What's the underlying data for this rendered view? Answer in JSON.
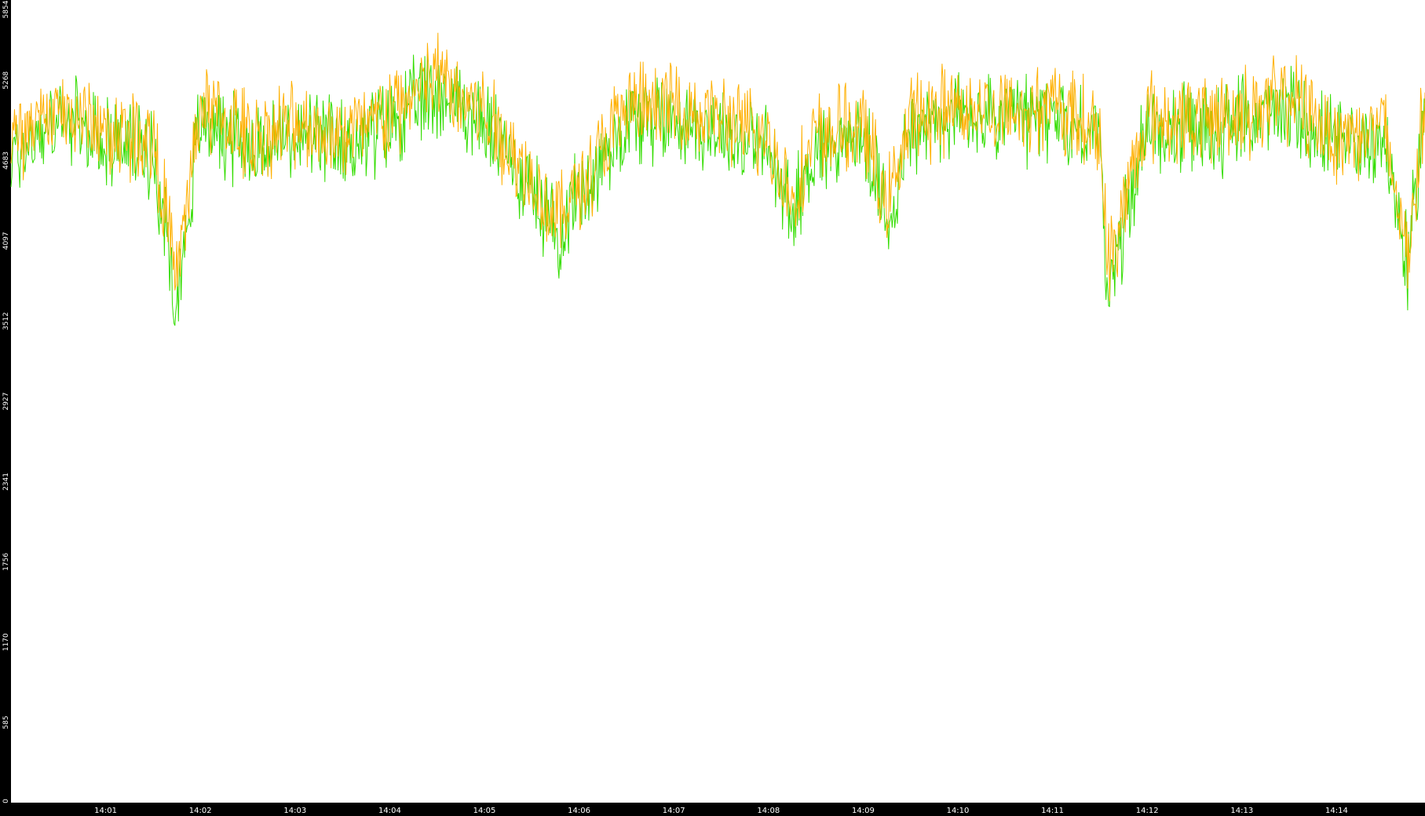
{
  "chart_data": {
    "type": "line",
    "title": "",
    "xlabel": "",
    "ylabel": "",
    "ylim": [
      0,
      5854
    ],
    "y_ticks": [
      "0",
      "585",
      "1170",
      "1756",
      "2341",
      "2927",
      "3512",
      "4097",
      "4683",
      "5268",
      "5854"
    ],
    "x_ticks": [
      "14:01",
      "14:02",
      "14:03",
      "14:04",
      "14:05",
      "14:06",
      "14:07",
      "14:08",
      "14:09",
      "14:10",
      "14:11",
      "14:12",
      "14:13",
      "14:14"
    ],
    "xlim": [
      "14:00:00",
      "14:14:56"
    ],
    "grid": false,
    "legend": "none",
    "colors": {
      "background": "#000000",
      "plot_background": "#ffffff",
      "tick_text": "#ffffff"
    },
    "series": [
      {
        "color": "#33dd00",
        "x": [
          "14:00:00",
          "14:00:30",
          "14:01:00",
          "14:01:30",
          "14:01:45",
          "14:02:00",
          "14:02:30",
          "14:03:00",
          "14:03:30",
          "14:04:00",
          "14:04:30",
          "14:05:00",
          "14:05:30",
          "14:05:45",
          "14:06:00",
          "14:06:30",
          "14:07:00",
          "14:07:30",
          "14:08:00",
          "14:08:15",
          "14:08:30",
          "14:09:00",
          "14:09:15",
          "14:09:30",
          "14:10:00",
          "14:10:30",
          "14:11:00",
          "14:11:30",
          "14:11:35",
          "14:12:00",
          "14:12:30",
          "14:13:00",
          "14:13:30",
          "14:14:00",
          "14:14:30",
          "14:14:45",
          "14:14:56"
        ],
        "values": [
          4700,
          4980,
          4820,
          4760,
          3650,
          5000,
          4780,
          4860,
          4790,
          4940,
          5210,
          4950,
          4480,
          4150,
          4420,
          4980,
          5000,
          4900,
          4750,
          4300,
          4780,
          4860,
          4240,
          4900,
          5000,
          4960,
          5010,
          4830,
          3700,
          4930,
          4880,
          4960,
          5060,
          4780,
          4850,
          3900,
          5100
        ]
      },
      {
        "color": "#ffb000",
        "x": [
          "14:00:00",
          "14:00:30",
          "14:01:00",
          "14:01:30",
          "14:01:45",
          "14:02:00",
          "14:02:30",
          "14:03:00",
          "14:03:30",
          "14:04:00",
          "14:04:30",
          "14:05:00",
          "14:05:30",
          "14:05:45",
          "14:06:00",
          "14:06:30",
          "14:07:00",
          "14:07:30",
          "14:08:00",
          "14:08:15",
          "14:08:30",
          "14:09:00",
          "14:09:15",
          "14:09:30",
          "14:10:00",
          "14:10:30",
          "14:11:00",
          "14:11:30",
          "14:11:35",
          "14:12:00",
          "14:12:30",
          "14:13:00",
          "14:13:30",
          "14:14:00",
          "14:14:30",
          "14:14:45",
          "14:14:56"
        ],
        "values": [
          4780,
          5060,
          4900,
          4860,
          3800,
          5080,
          4860,
          4940,
          4880,
          5020,
          5300,
          5030,
          4560,
          4250,
          4500,
          5060,
          5080,
          4980,
          4830,
          4400,
          4860,
          4940,
          4340,
          4980,
          5080,
          5040,
          5090,
          4910,
          3900,
          5010,
          4960,
          5040,
          5140,
          4860,
          4930,
          3950,
          5180
        ]
      }
    ]
  }
}
